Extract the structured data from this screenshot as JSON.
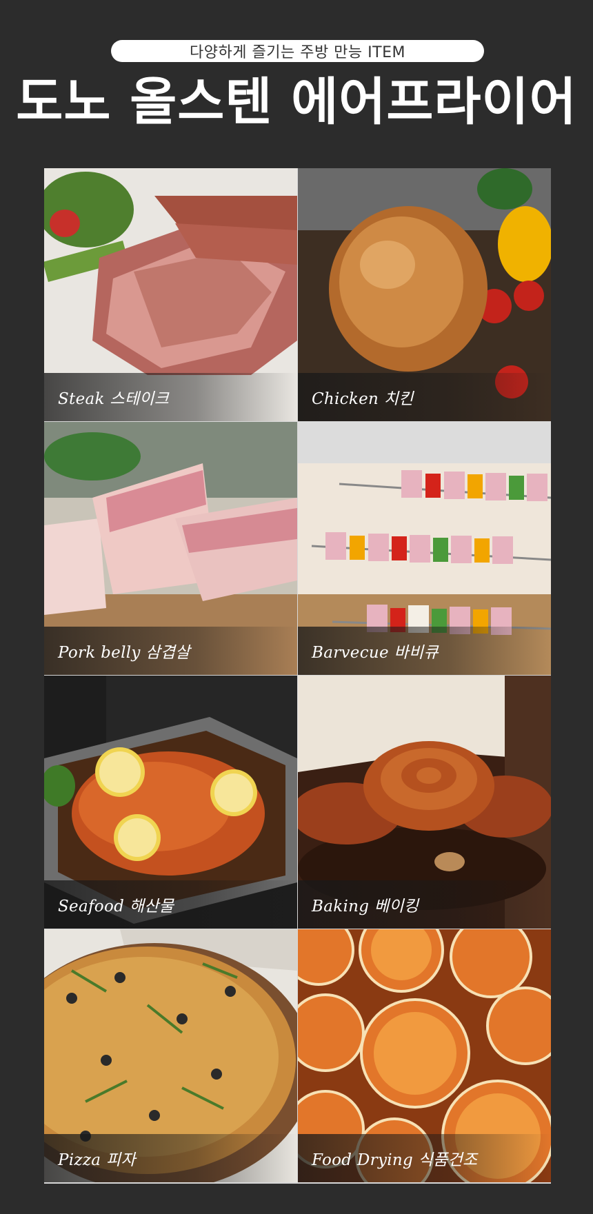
{
  "header": {
    "tagline": "다양하게 즐기는 주방 만능 ITEM",
    "title": "도노 올스텐 에어프라이어"
  },
  "items": [
    {
      "caption": "Steak 스테이크",
      "icon": "steak-photo"
    },
    {
      "caption": "Chicken 치킨",
      "icon": "roast-chicken-photo"
    },
    {
      "caption": "Pork belly 삼겹살",
      "icon": "pork-belly-photo"
    },
    {
      "caption": "Barvecue 바비큐",
      "icon": "barbecue-skewers-photo"
    },
    {
      "caption": "Seafood 해산물",
      "icon": "seafood-basket-photo"
    },
    {
      "caption": "Baking 베이킹",
      "icon": "pastry-photo"
    },
    {
      "caption": "Pizza 피자",
      "icon": "pizza-photo"
    },
    {
      "caption": "Food Drying 식품건조",
      "icon": "dried-orange-photo"
    }
  ],
  "colors": {
    "background": "#2c2c2c",
    "pill": "#ffffff",
    "text": "#ffffff"
  }
}
